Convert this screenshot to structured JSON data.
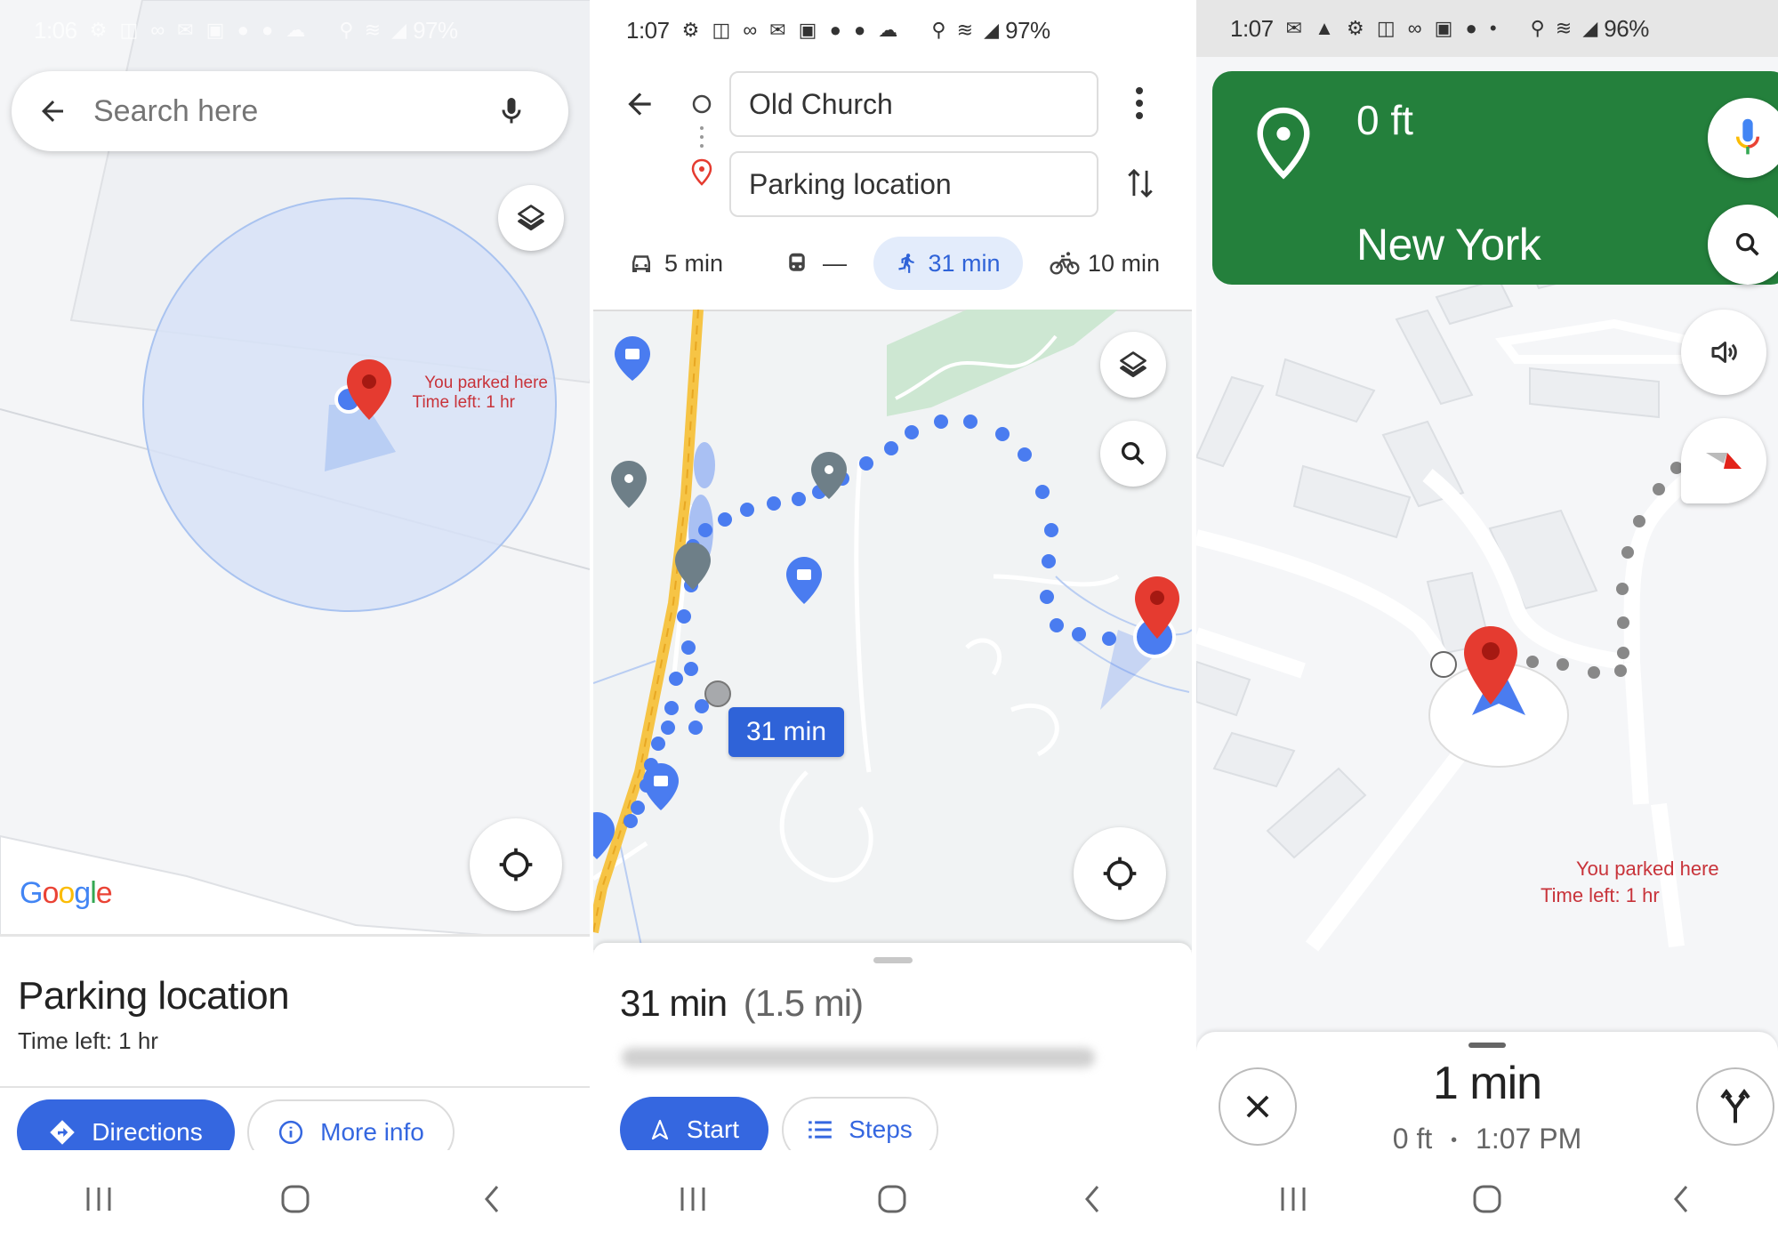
{
  "panels": {
    "parking": {
      "status_bar": {
        "time": "1:06",
        "icons": "⚙ ◫ ∞ ✉ ▣ ● ● ☁",
        "right_icons": "⚲ ≋ ◢",
        "battery": "97%"
      },
      "search": {
        "placeholder": "Search here"
      },
      "map": {
        "marker_label_line1": "You parked here",
        "marker_label_line2": "Time left: 1 hr",
        "logo": [
          "G",
          "o",
          "o",
          "g",
          "l",
          "e"
        ],
        "logo_colors": [
          "#4285f4",
          "#ea4335",
          "#fbbc05",
          "#4285f4",
          "#34a853",
          "#ea4335"
        ]
      },
      "sheet": {
        "title": "Parking location",
        "subtitle": "Time left: 1 hr",
        "directions_label": "Directions",
        "more_info_label": "More info"
      }
    },
    "directions": {
      "status_bar": {
        "time": "1:07",
        "icons": "⚙ ◫ ∞ ✉ ▣ ● ● ☁",
        "right_icons": "⚲ ≋ ◢",
        "battery": "97%"
      },
      "origin": "Old Church",
      "destination": "Parking location",
      "modes": [
        {
          "name": "drive",
          "label": "5 min",
          "selected": false
        },
        {
          "name": "transit",
          "label": "—",
          "selected": false
        },
        {
          "name": "walk",
          "label": "31 min",
          "selected": true
        },
        {
          "name": "bike",
          "label": "10 min",
          "selected": false
        }
      ],
      "map": {
        "route_callout": "31 min"
      },
      "sheet": {
        "duration": "31 min",
        "distance": "(1.5 mi)",
        "start_label": "Start",
        "steps_label": "Steps"
      }
    },
    "navigation": {
      "status_bar": {
        "time": "1:07",
        "icons": "✉ ▲ ⚙ ◫ ∞ ▣ ● •",
        "right_icons": "⚲ ≋ ◢",
        "battery": "96%"
      },
      "banner": {
        "distance": "0 ft",
        "place": "New York",
        "color": "#24803c"
      },
      "map": {
        "marker_label_line1": "You parked here",
        "marker_label_line2": "Time left: 1 hr"
      },
      "sheet": {
        "eta": "1 min",
        "distance": "0 ft",
        "separator": "•",
        "arrival_time": "1:07 PM"
      }
    }
  },
  "colors": {
    "accent_blue": "#3567e0",
    "marker_red": "#e53b30",
    "nav_green": "#24803c",
    "route_dot": "#4a7cf0"
  }
}
